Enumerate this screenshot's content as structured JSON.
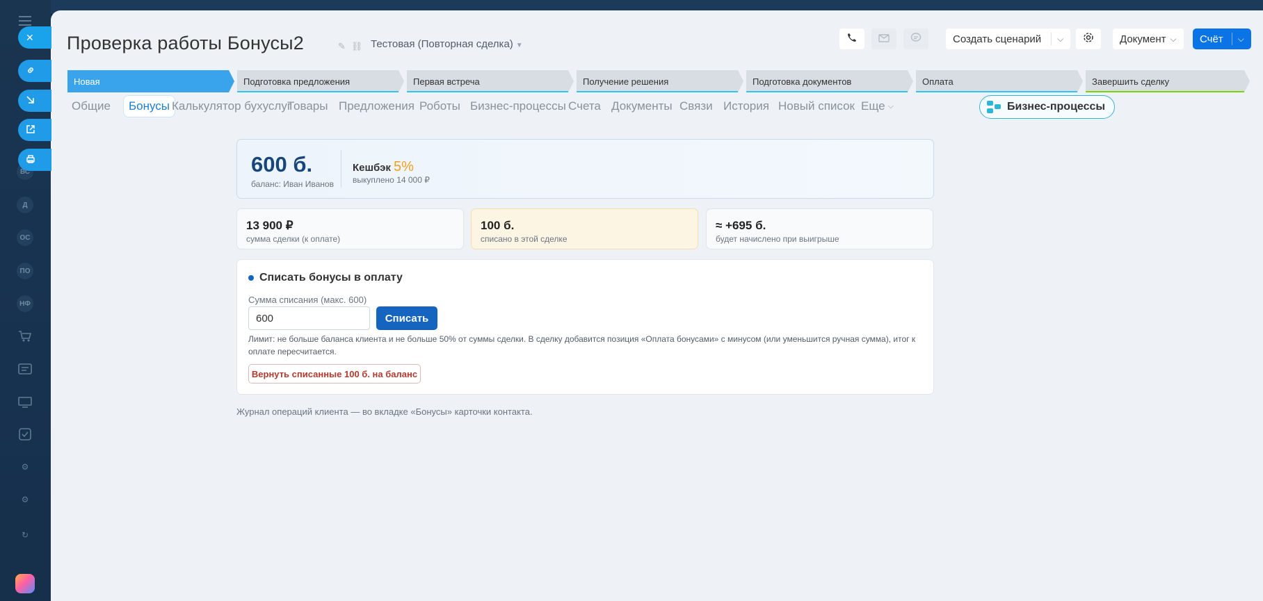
{
  "sidebar": {
    "items": [
      {
        "label": "ВС"
      },
      {
        "label": "Д"
      },
      {
        "label": "ОС"
      },
      {
        "label": "ПО"
      },
      {
        "label": "НФ"
      }
    ]
  },
  "header": {
    "title": "Проверка работы Бонусы2",
    "deal_type": "Тестовая (Повторная сделка)",
    "create_scenario": "Создать сценарий",
    "document": "Документ",
    "invoice": "Счёт"
  },
  "stages": [
    {
      "label": "Новая",
      "color": "#39a3ec",
      "active": true
    },
    {
      "label": "Подготовка предложения",
      "color": "#2fc6f6"
    },
    {
      "label": "Первая встреча",
      "color": "#2fc6f6"
    },
    {
      "label": "Получение решения",
      "color": "#2fc6f6"
    },
    {
      "label": "Подготовка документов",
      "color": "#2fc6f6"
    },
    {
      "label": "Оплата",
      "color": "#2fc6f6"
    },
    {
      "label": "Завершить сделку",
      "color": "#7bd500"
    }
  ],
  "tabs": [
    {
      "label": "Общие"
    },
    {
      "label": "Бонусы",
      "active": true
    },
    {
      "label": "Калькулятор бухуслуг"
    },
    {
      "label": "Товары"
    },
    {
      "label": "Предложения"
    },
    {
      "label": "Роботы"
    },
    {
      "label": "Бизнес-процессы"
    },
    {
      "label": "Счета"
    },
    {
      "label": "Документы"
    },
    {
      "label": "Связи"
    },
    {
      "label": "История"
    },
    {
      "label": "Новый список"
    },
    {
      "label": "Еще"
    }
  ],
  "bp_button": "Бизнес-процессы",
  "bonus": {
    "balance": "600 б.",
    "balance_sub": "баланс: Иван Иванов",
    "cashback_label": "Кешбэк",
    "cashback_pct": "5%",
    "bought_out": "выкуплено 14 000 ₽",
    "stats": [
      {
        "value": "13 900 ₽",
        "label": "сумма сделки (к оплате)"
      },
      {
        "value": "100 б.",
        "label": "списано в этой сделке"
      },
      {
        "value": "≈ +695 б.",
        "label": "будет начислено при выигрыше"
      }
    ],
    "form": {
      "title": "Списать бонусы в оплату",
      "field_label": "Сумма списания (макс. 600)",
      "amount": "600",
      "charge_button": "Списать",
      "limit_text": "Лимит: не больше баланса клиента и не больше 50% от суммы сделки. В сделку добавится позиция «Оплата бонусами» с минусом (или уменьшится ручная сумма), итог к оплате пересчитается.",
      "return_button": "Вернуть списанные 100 б. на баланс"
    },
    "journal": "Журнал операций клиента — во вкладке «Бонусы» карточки контакта."
  }
}
